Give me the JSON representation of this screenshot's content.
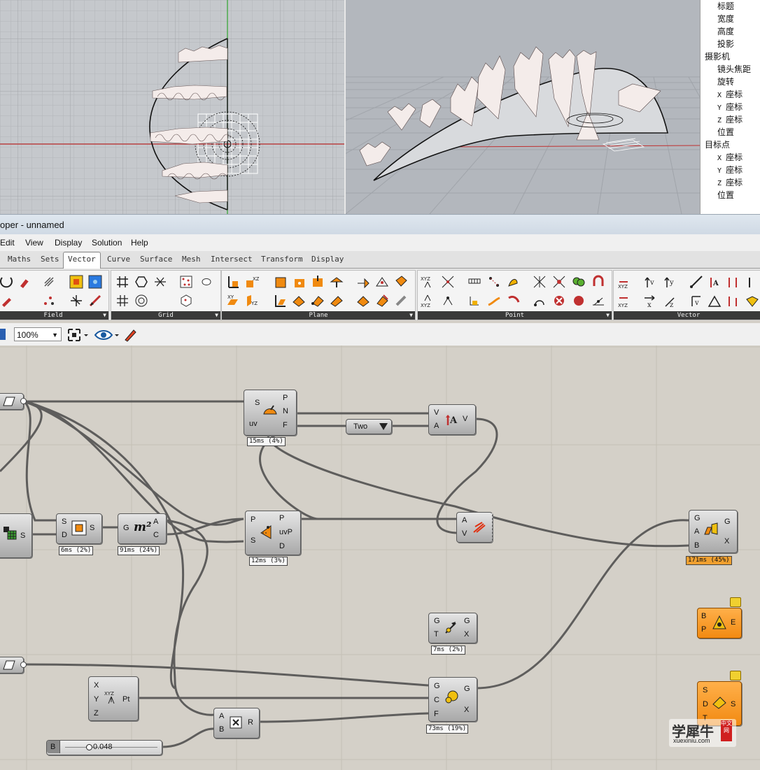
{
  "window": {
    "title_fragment": "oper - unnamed"
  },
  "properties": {
    "rows": [
      {
        "kind": "item",
        "label": "标题"
      },
      {
        "kind": "item",
        "label": "宽度"
      },
      {
        "kind": "item",
        "label": "高度"
      },
      {
        "kind": "item",
        "label": "投影"
      },
      {
        "kind": "sec",
        "label": "摄影机"
      },
      {
        "kind": "item",
        "label": "镜头焦距"
      },
      {
        "kind": "item",
        "label": "旋转"
      },
      {
        "kind": "sub",
        "axis": "X",
        "label": "座标"
      },
      {
        "kind": "sub",
        "axis": "Y",
        "label": "座标"
      },
      {
        "kind": "sub",
        "axis": "Z",
        "label": "座标"
      },
      {
        "kind": "item",
        "label": "位置"
      },
      {
        "kind": "sec",
        "label": "目标点"
      },
      {
        "kind": "sub",
        "axis": "X",
        "label": "座标"
      },
      {
        "kind": "sub",
        "axis": "Y",
        "label": "座标"
      },
      {
        "kind": "sub",
        "axis": "Z",
        "label": "座标"
      },
      {
        "kind": "item",
        "label": "位置"
      }
    ]
  },
  "menu": [
    "Edit",
    "View",
    "Display",
    "Solution",
    "Help"
  ],
  "tabs": [
    "Maths",
    "Sets",
    "Vector",
    "Curve",
    "Surface",
    "Mesh",
    "Intersect",
    "Transform",
    "Display"
  ],
  "active_tab": "Vector",
  "ribbon_groups": [
    "Field",
    "Grid",
    "Plane",
    "Point",
    "Vector"
  ],
  "toolbar": {
    "zoom": "100%"
  },
  "canvas": {
    "components": {
      "eval": {
        "in": [
          "S",
          "uv"
        ],
        "out": [
          "P",
          "N",
          "F"
        ],
        "timer": "15ms (4%)"
      },
      "amp": {
        "in": [
          "V",
          "A"
        ],
        "out": [
          "V"
        ]
      },
      "value_list": {
        "label": "Two"
      },
      "bounds": {
        "in": [
          "S",
          "D"
        ],
        "out": [
          "S"
        ],
        "timer": "6ms (2%)"
      },
      "area": {
        "in": [
          "G"
        ],
        "out": [
          "A",
          "C"
        ],
        "icon": "m²",
        "timer": "91ms (24%)"
      },
      "closest": {
        "in": [
          "P",
          "S"
        ],
        "out": [
          "P",
          "uvP",
          "D"
        ],
        "timer": "12ms (3%)"
      },
      "vec_display": {
        "in": [
          "A",
          "V"
        ]
      },
      "orient": {
        "in": [
          "G",
          "A",
          "B"
        ],
        "out": [
          "G",
          "X"
        ],
        "timer": "171ms (45%)"
      },
      "move": {
        "in": [
          "G",
          "T"
        ],
        "out": [
          "G",
          "X"
        ],
        "timer": "7ms (2%)"
      },
      "orange1": {
        "in": [
          "B",
          "P"
        ],
        "out": [
          "E"
        ]
      },
      "point": {
        "in": [
          "X",
          "Y",
          "Z"
        ],
        "out": [
          "Pt"
        ]
      },
      "scale": {
        "in": [
          "G",
          "C",
          "F"
        ],
        "out": [
          "G",
          "X"
        ],
        "timer": "73ms (19%)"
      },
      "mult": {
        "in": [
          "A",
          "B"
        ],
        "out": [
          "R"
        ]
      },
      "orange2": {
        "in": [
          "S",
          "D",
          "T"
        ],
        "out": [
          "S"
        ]
      },
      "slider": {
        "name": "B",
        "value": "0.048"
      }
    }
  },
  "watermark": {
    "text": "学犀牛",
    "badge": "中文网",
    "url": "xuexiniu.com"
  }
}
